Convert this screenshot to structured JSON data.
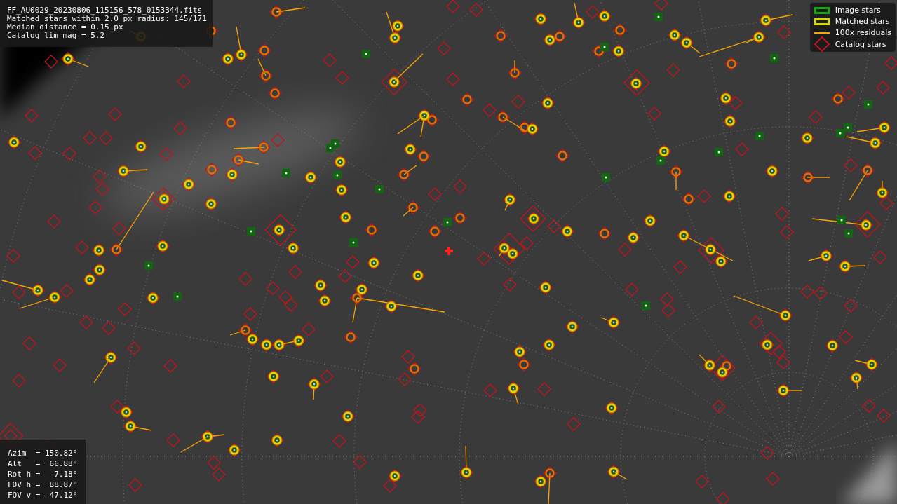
{
  "header": {
    "lines": [
      "FF_AU0029_20230806_115156_578_0153344.fits",
      "Matched stars within 2.0 px radius: 145/171",
      "Median distance = 0.15 px",
      "Catalog lim mag = 5.2"
    ]
  },
  "legend": [
    {
      "kind": "image-box",
      "label": "Image stars"
    },
    {
      "kind": "matched-box",
      "label": "Matched stars"
    },
    {
      "kind": "residual-line",
      "label": "100x residuals"
    },
    {
      "kind": "catalog-diamond",
      "label": "Catalog stars"
    }
  ],
  "pointing": {
    "lines": [
      "Azim  = 150.82°",
      "Alt   =  66.88°",
      "Rot h =  -7.18°",
      "FOV h =  88.87°",
      "FOV v =  47.12°"
    ]
  }
}
